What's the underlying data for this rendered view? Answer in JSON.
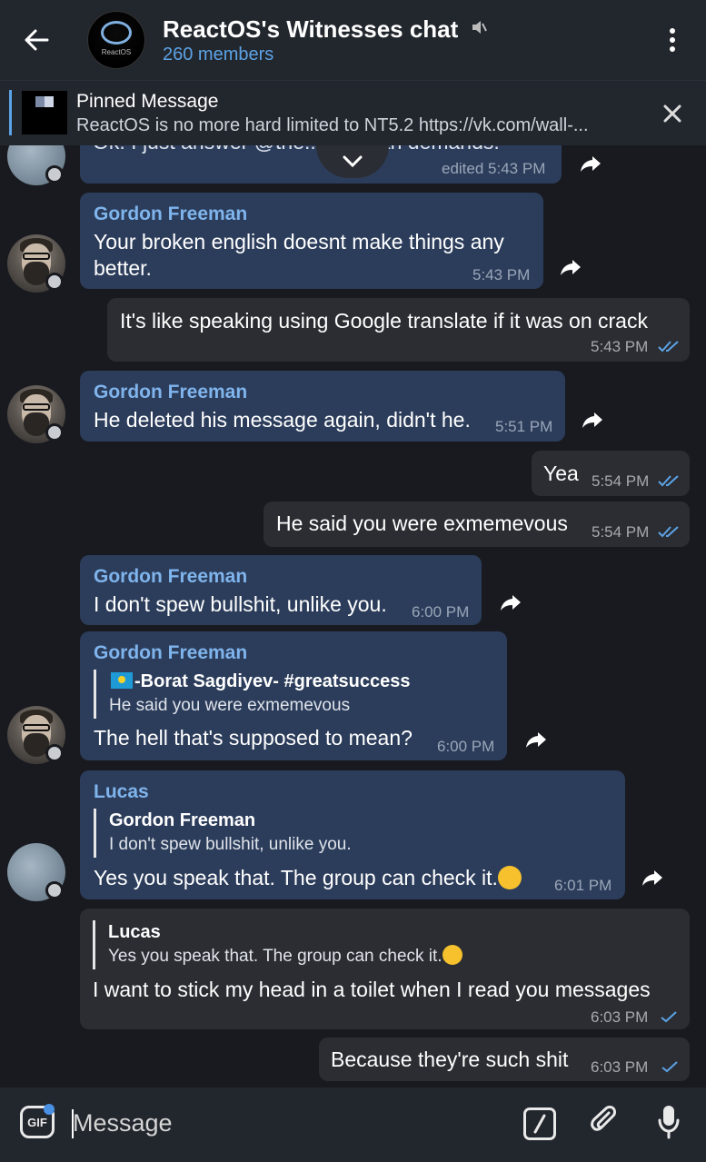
{
  "header": {
    "title": "ReactOS's Witnesses chat",
    "subtitle": "260 members",
    "avatar_text": "ReactOS"
  },
  "pinned": {
    "title": "Pinned Message",
    "text": "ReactOS is no more hard limited to NT5.2 https://vk.com/wall-..."
  },
  "messages": [
    {
      "id": "m0",
      "direction": "in",
      "text": "Ok. I just answer @the... ...in ban demands.",
      "time": "edited 5:43 PM"
    },
    {
      "id": "m1",
      "direction": "in",
      "sender": "Gordon Freeman",
      "lines": [
        "Your broken english doesnt make things any",
        "better."
      ],
      "time": "5:43 PM"
    },
    {
      "id": "m2",
      "direction": "out",
      "text": "It's like speaking using Google translate if it was on crack",
      "time": "5:43 PM"
    },
    {
      "id": "m3",
      "direction": "in",
      "sender": "Gordon Freeman",
      "text": "He deleted his message again, didn't he.",
      "time": "5:51 PM"
    },
    {
      "id": "m4",
      "direction": "out",
      "text": "Yea",
      "time": "5:54 PM"
    },
    {
      "id": "m5",
      "direction": "out",
      "text": "He said you were exmemevous",
      "time": "5:54 PM"
    },
    {
      "id": "m6",
      "direction": "in",
      "sender": "Gordon Freeman",
      "text": "I don't spew bullshit, unlike you.",
      "time": "6:00 PM"
    },
    {
      "id": "m7",
      "direction": "in",
      "sender": "Gordon Freeman",
      "reply_name": "-Borat Sagdiyev- #greatsuccess",
      "reply_text": "He said you were exmemevous",
      "text": "The hell that's supposed to mean?",
      "time": "6:00 PM"
    },
    {
      "id": "m8",
      "direction": "in",
      "sender": "Lucas",
      "reply_name": "Gordon Freeman",
      "reply_text": "I don't spew bullshit, unlike you.",
      "text": "Yes you speak that. The group can check it.",
      "time": "6:01 PM"
    },
    {
      "id": "m9",
      "direction": "out",
      "reply_name": "Lucas",
      "reply_text": "Yes you speak that. The group can check it.",
      "text": "I want to stick my head in a toilet when I read you messages",
      "time": "6:03 PM"
    },
    {
      "id": "m10",
      "direction": "out",
      "text": "Because they're such shit",
      "time": "6:03 PM"
    }
  ],
  "input": {
    "placeholder": "Message",
    "gif_label": "GIF"
  },
  "colors": {
    "accent": "#5ca3e6",
    "incoming_bubble": "#2c3d5b",
    "outgoing_bubble": "#2b2d32",
    "sender_name": "#7fb4ec",
    "background": "#181a1f",
    "bar": "#22262d"
  },
  "icons": [
    "back-arrow-icon",
    "mute-icon",
    "more-vert-icon",
    "close-icon",
    "share-icon",
    "chevron-down-icon",
    "double-check-icon",
    "single-check-icon",
    "gif-icon",
    "command-icon",
    "paperclip-icon",
    "mic-icon",
    "emoji-wink-icon",
    "kazakhstan-flag-icon"
  ]
}
